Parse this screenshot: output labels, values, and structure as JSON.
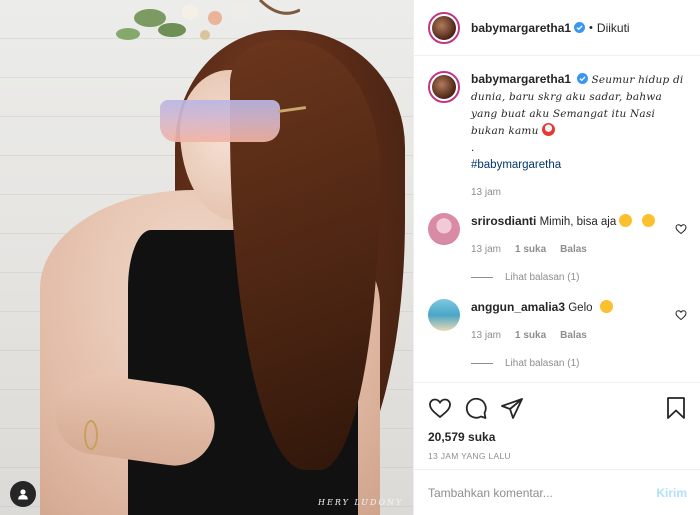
{
  "post": {
    "watermark": "HERY LUDONY",
    "tag_icon": "user-icon"
  },
  "header": {
    "username": "babymargaretha1",
    "verified_icon": "verified-badge-icon",
    "separator": "•",
    "follow_status": "Diikuti"
  },
  "caption": {
    "username": "babymargaretha1",
    "text": "Seumur hidup di dunia, baru skrg aku sadar, bahwa yang buat aku Semangat itu Nasi bukan kamu",
    "dot": ".",
    "hashtag": "#babymargaretha",
    "time": "13 jam"
  },
  "comments": [
    {
      "username": "srirosdianti",
      "text": "Mimih, bisa aja",
      "time": "13 jam",
      "likes": "1 suka",
      "reply": "Balas",
      "view_replies": "Lihat balasan (1)",
      "avatar_color": "#d98aa5"
    },
    {
      "username": "anggun_amalia3",
      "text": "Gelo",
      "time": "13 jam",
      "likes": "1 suka",
      "reply": "Balas",
      "view_replies": "Lihat balasan (1)",
      "avatar_color": "#4aa6c6"
    }
  ],
  "actions": {
    "like_icon": "heart-icon",
    "comment_icon": "comment-icon",
    "share_icon": "send-icon",
    "save_icon": "bookmark-icon",
    "likes": "20,579 suka",
    "posted_ago": "13 JAM YANG LALU"
  },
  "composer": {
    "placeholder": "Tambahkan komentar...",
    "send_label": "Kirim"
  },
  "colors": {
    "ring": "#c13584",
    "verified": "#3897f0",
    "link": "#00376b",
    "muted": "#8e8e8e",
    "send_disabled": "#b2dffc"
  }
}
